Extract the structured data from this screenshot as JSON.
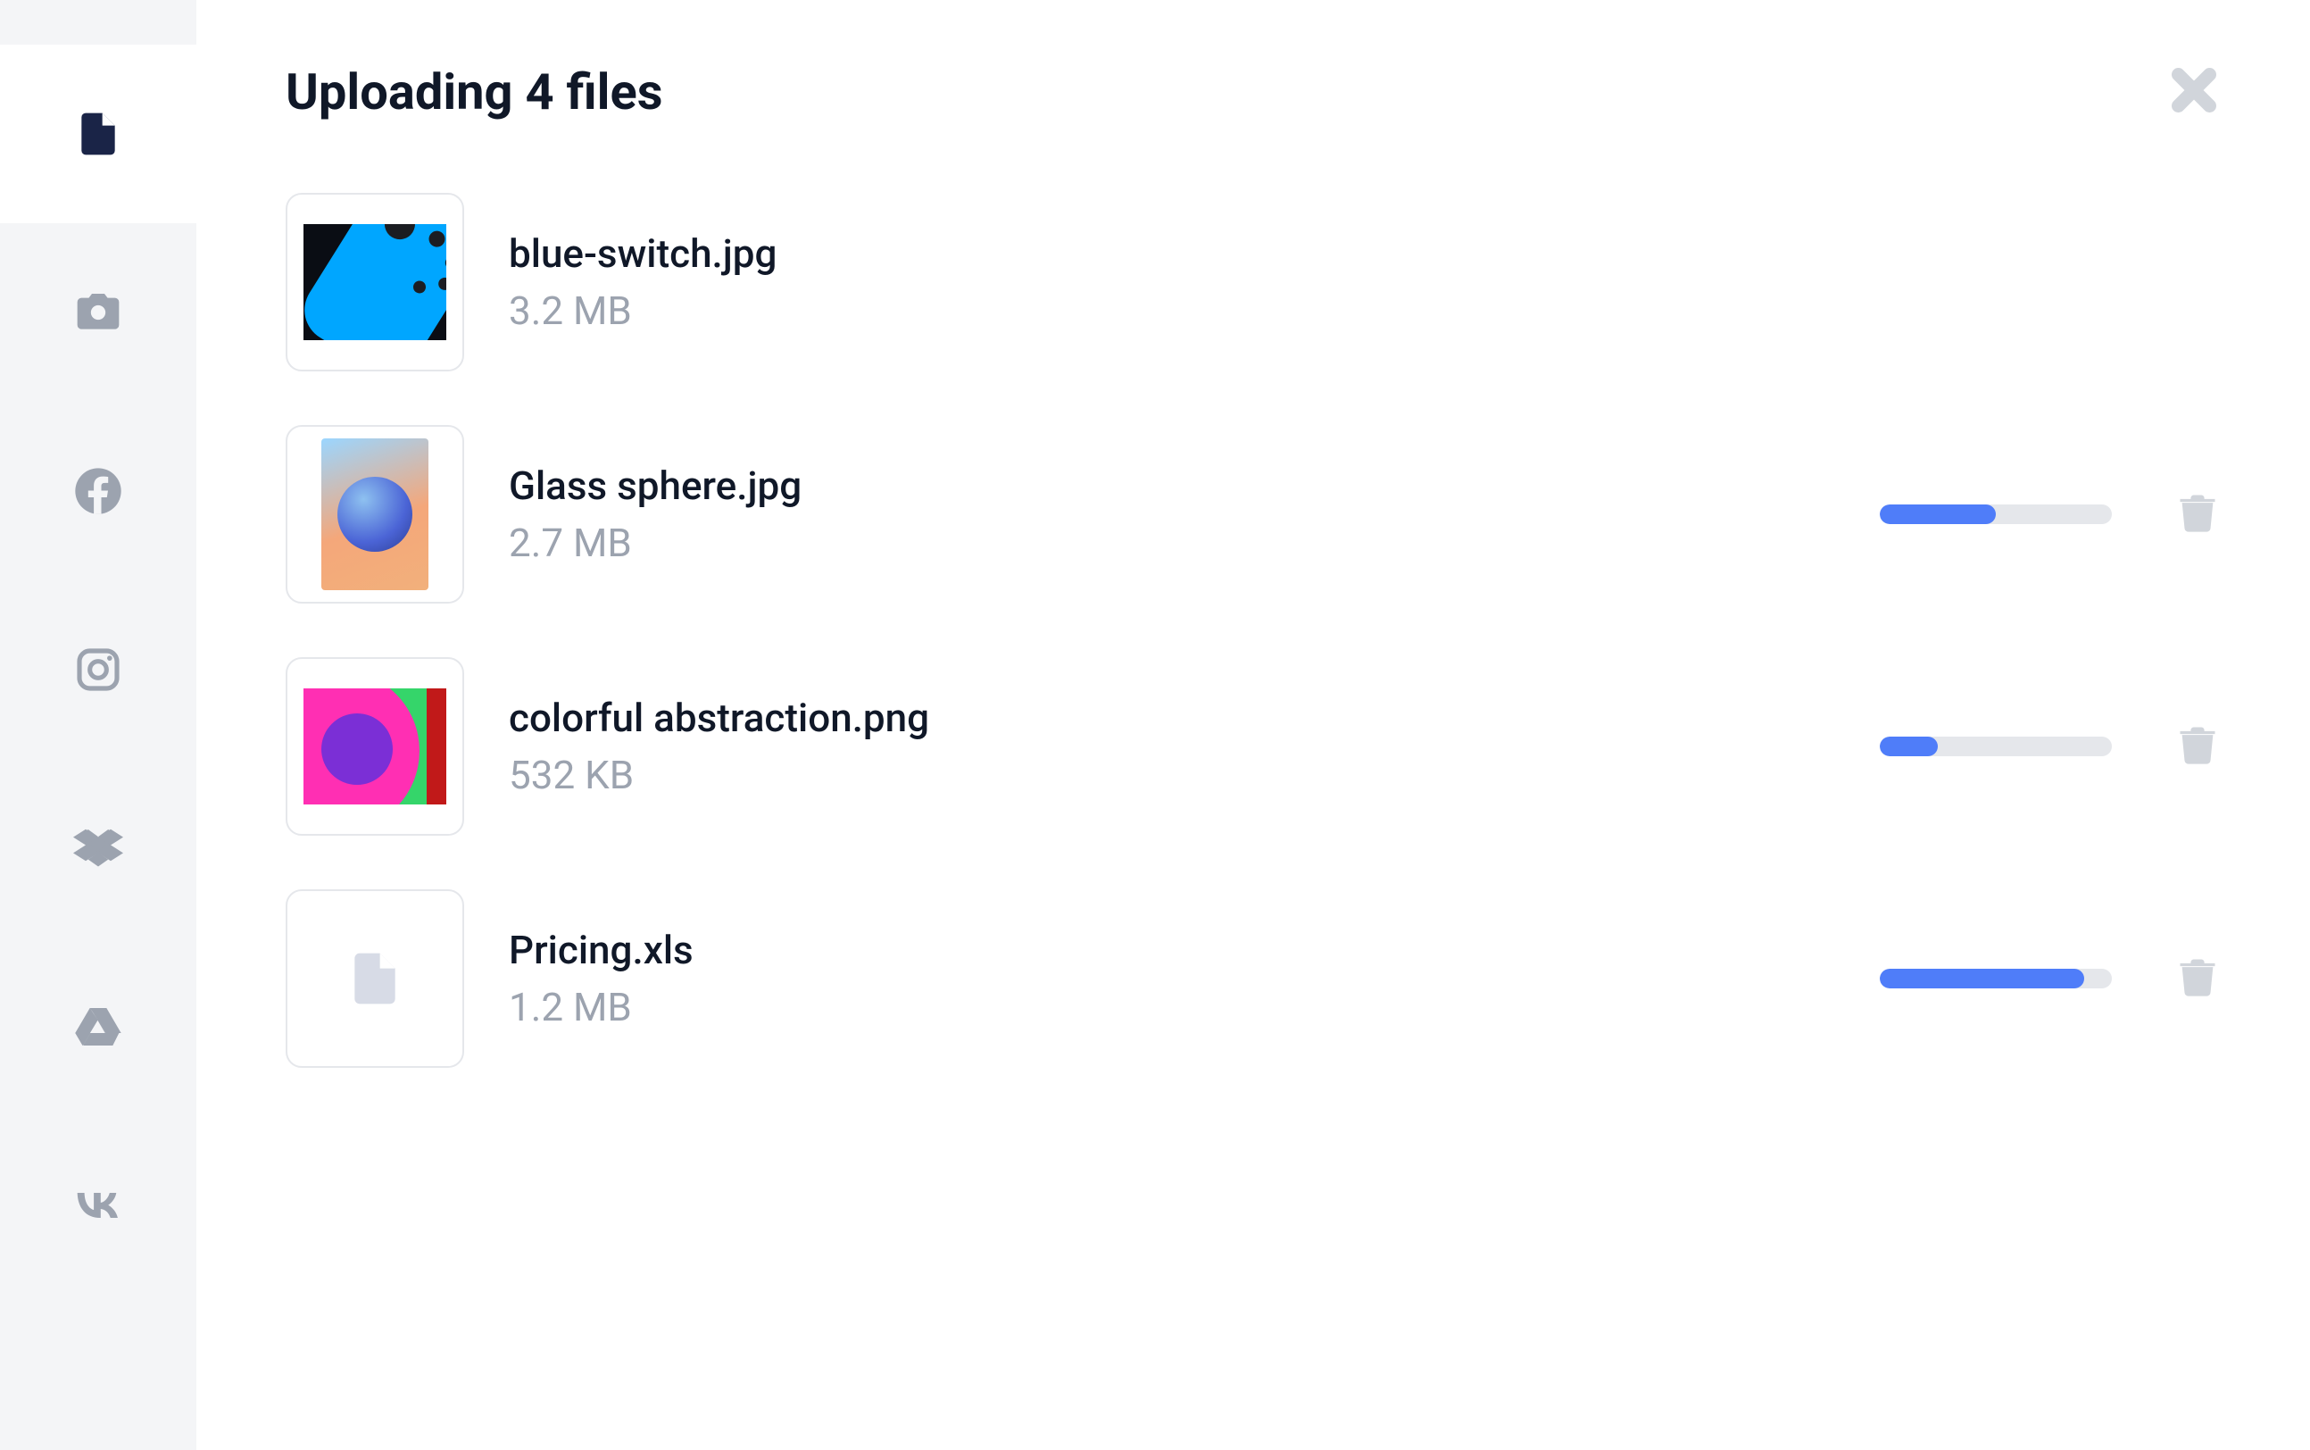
{
  "header": {
    "title": "Uploading 4 files"
  },
  "sidebar": {
    "sources": [
      {
        "id": "local-files",
        "icon": "file-icon",
        "active": true
      },
      {
        "id": "camera",
        "icon": "camera-icon",
        "active": false
      },
      {
        "id": "facebook",
        "icon": "facebook-icon",
        "active": false
      },
      {
        "id": "instagram",
        "icon": "instagram-icon",
        "active": false
      },
      {
        "id": "dropbox",
        "icon": "dropbox-icon",
        "active": false
      },
      {
        "id": "google-drive",
        "icon": "google-drive-icon",
        "active": false
      },
      {
        "id": "vk",
        "icon": "vk-icon",
        "active": false
      }
    ]
  },
  "files": [
    {
      "name": "blue-switch.jpg",
      "size": "3.2 MB",
      "thumb": "switch",
      "progress": null,
      "deletable": false
    },
    {
      "name": "Glass sphere.jpg",
      "size": "2.7 MB",
      "thumb": "sphere",
      "progress": 50,
      "deletable": true
    },
    {
      "name": "colorful abstraction.png",
      "size": "532 KB",
      "thumb": "abstract",
      "progress": 25,
      "deletable": true
    },
    {
      "name": "Pricing.xls",
      "size": "1.2 MB",
      "thumb": "doc",
      "progress": 88,
      "deletable": true
    }
  ],
  "colors": {
    "accent": "#4f7df9",
    "muted": "#9ca3af",
    "border": "#e5e7eb"
  }
}
